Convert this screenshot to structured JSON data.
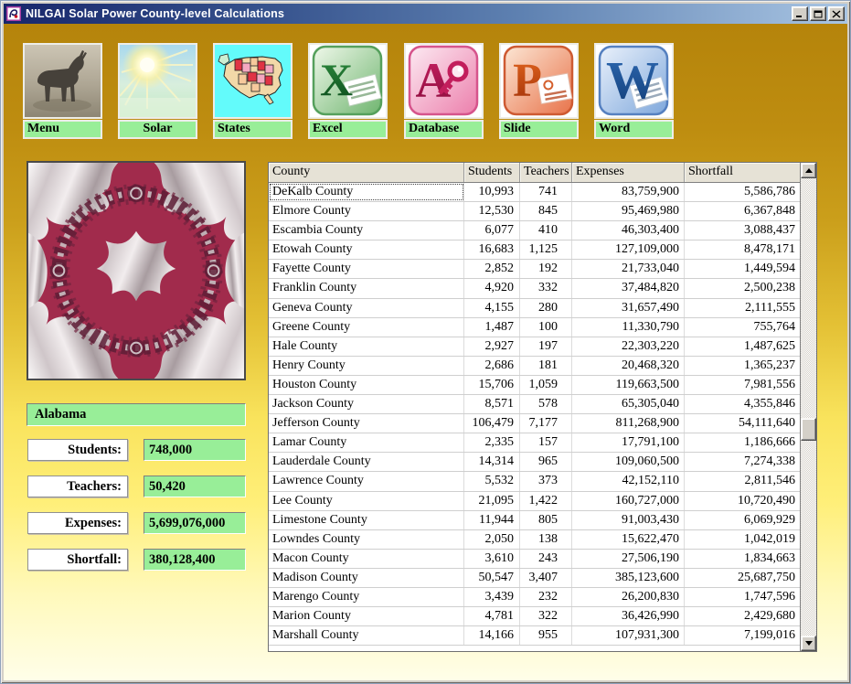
{
  "window": {
    "title": "NILGAI Solar Power County-level Calculations"
  },
  "toolbar": {
    "buttons": [
      {
        "label": "Menu"
      },
      {
        "label": "Solar"
      },
      {
        "label": "States"
      },
      {
        "label": "Excel"
      },
      {
        "label": "Database"
      },
      {
        "label": "Slide"
      },
      {
        "label": "Word"
      }
    ]
  },
  "summary": {
    "state": "Alabama",
    "fields": [
      {
        "label": "Students:",
        "value": "748,000"
      },
      {
        "label": "Teachers:",
        "value": "50,420"
      },
      {
        "label": "Expenses:",
        "value": "5,699,076,000"
      },
      {
        "label": "Shortfall:",
        "value": "380,128,400"
      }
    ]
  },
  "table": {
    "columns": [
      "County",
      "Students",
      "Teachers",
      "Expenses",
      "Shortfall"
    ],
    "rows": [
      [
        "DeKalb County",
        "10,993",
        "741",
        "83,759,900",
        "5,586,786"
      ],
      [
        "Elmore County",
        "12,530",
        "845",
        "95,469,980",
        "6,367,848"
      ],
      [
        "Escambia County",
        "6,077",
        "410",
        "46,303,400",
        "3,088,437"
      ],
      [
        "Etowah County",
        "16,683",
        "1,125",
        "127,109,000",
        "8,478,171"
      ],
      [
        "Fayette County",
        "2,852",
        "192",
        "21,733,040",
        "1,449,594"
      ],
      [
        "Franklin County",
        "4,920",
        "332",
        "37,484,820",
        "2,500,238"
      ],
      [
        "Geneva County",
        "4,155",
        "280",
        "31,657,490",
        "2,111,555"
      ],
      [
        "Greene County",
        "1,487",
        "100",
        "11,330,790",
        "755,764"
      ],
      [
        "Hale County",
        "2,927",
        "197",
        "22,303,220",
        "1,487,625"
      ],
      [
        "Henry County",
        "2,686",
        "181",
        "20,468,320",
        "1,365,237"
      ],
      [
        "Houston County",
        "15,706",
        "1,059",
        "119,663,500",
        "7,981,556"
      ],
      [
        "Jackson County",
        "8,571",
        "578",
        "65,305,040",
        "4,355,846"
      ],
      [
        "Jefferson County",
        "106,479",
        "7,177",
        "811,268,900",
        "54,111,640"
      ],
      [
        "Lamar County",
        "2,335",
        "157",
        "17,791,100",
        "1,186,666"
      ],
      [
        "Lauderdale County",
        "14,314",
        "965",
        "109,060,500",
        "7,274,338"
      ],
      [
        "Lawrence County",
        "5,532",
        "373",
        "42,152,110",
        "2,811,546"
      ],
      [
        "Lee County",
        "21,095",
        "1,422",
        "160,727,000",
        "10,720,490"
      ],
      [
        "Limestone County",
        "11,944",
        "805",
        "91,003,430",
        "6,069,929"
      ],
      [
        "Lowndes County",
        "2,050",
        "138",
        "15,622,470",
        "1,042,019"
      ],
      [
        "Macon County",
        "3,610",
        "243",
        "27,506,190",
        "1,834,663"
      ],
      [
        "Madison County",
        "50,547",
        "3,407",
        "385,123,600",
        "25,687,750"
      ],
      [
        "Marengo County",
        "3,439",
        "232",
        "26,200,830",
        "1,747,596"
      ],
      [
        "Marion County",
        "4,781",
        "322",
        "36,426,990",
        "2,429,680"
      ],
      [
        "Marshall County",
        "14,166",
        "955",
        "107,931,300",
        "7,199,016"
      ]
    ]
  },
  "colors": {
    "accent_green": "#98EE98",
    "gold_top": "#B5840B",
    "cream_bottom": "#FFFEE9",
    "fractal_crimson": "#A12B4C",
    "titlebar_left": "#17266B",
    "titlebar_right": "#A9C5E3"
  }
}
